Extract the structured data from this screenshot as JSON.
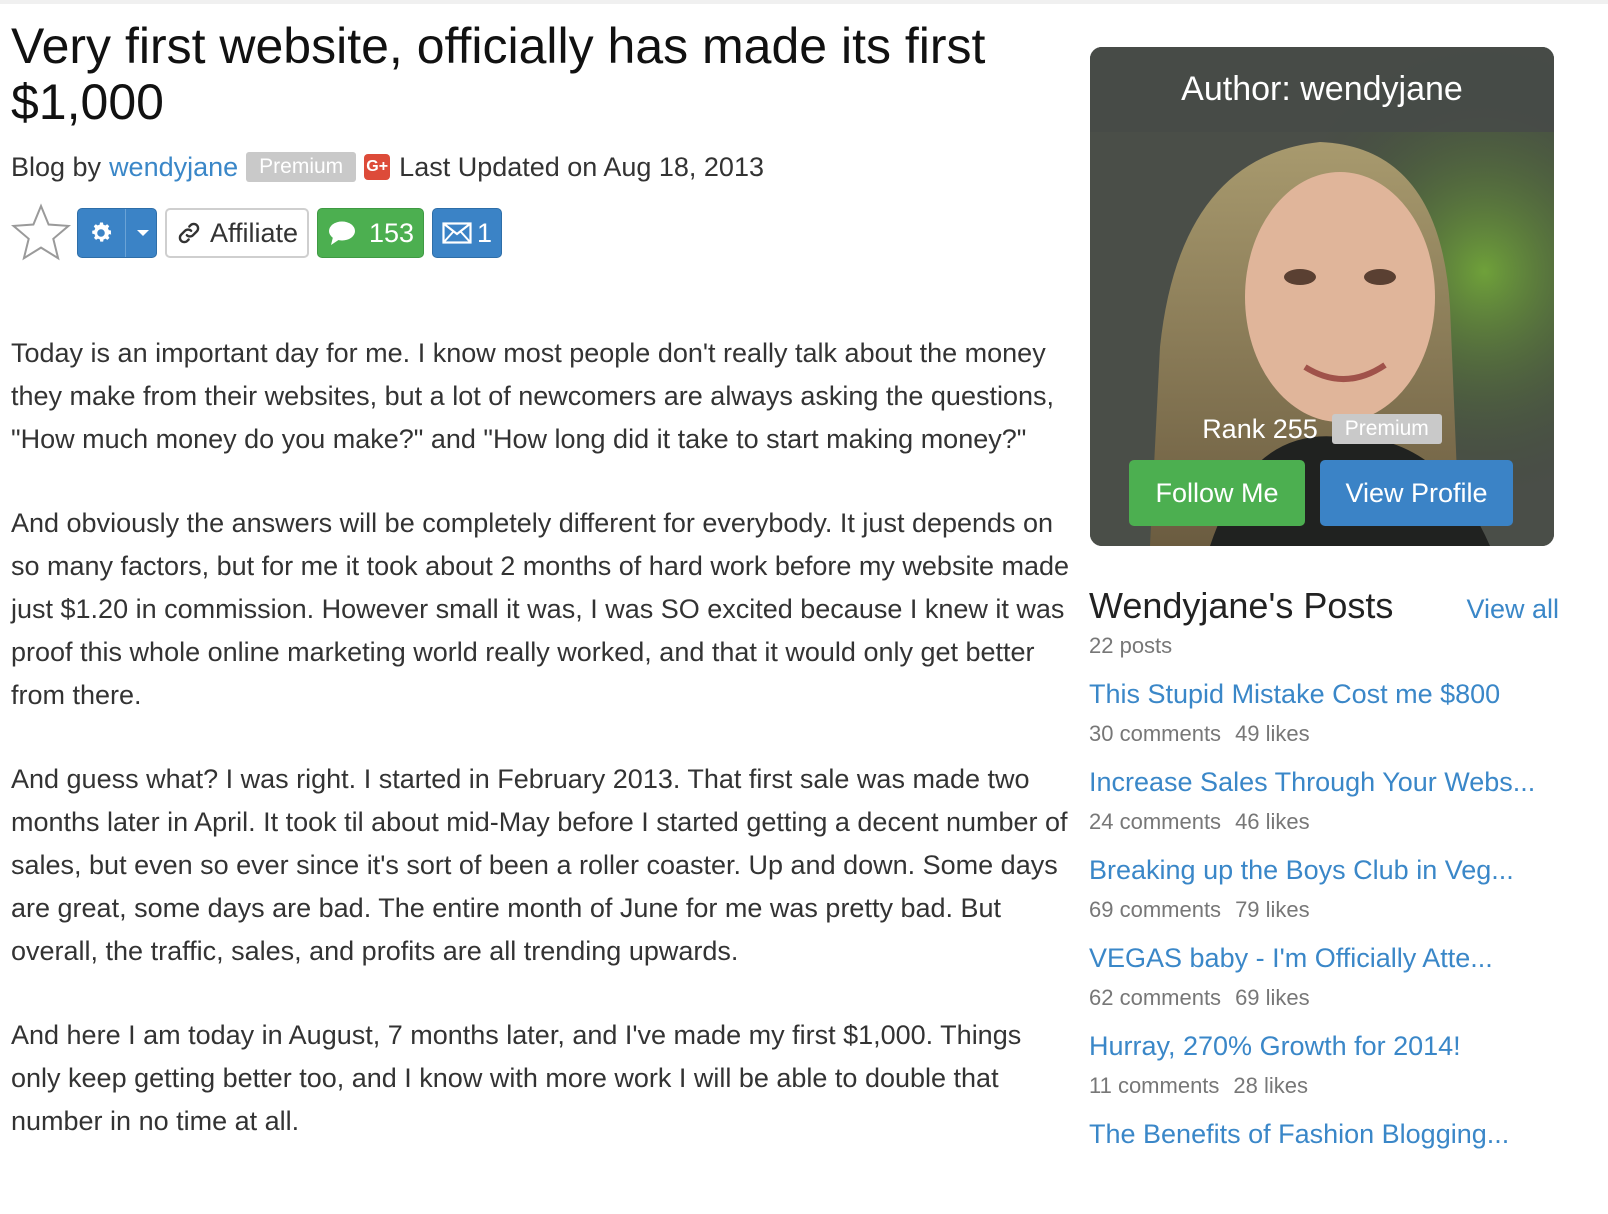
{
  "post": {
    "title": "Very first website, officially has made its first $1,000",
    "blog_by": "Blog by",
    "author": "wendyjane",
    "author_badge": "Premium",
    "gplus_label": "G+",
    "last_updated": "Last Updated on Aug 18, 2013"
  },
  "toolbar": {
    "affiliate_label": "Affiliate",
    "comments_count": "153",
    "messages_count": "1"
  },
  "article": {
    "paragraphs": [
      "Today is an important day for me. I know most people don't really talk about the money they make from their websites, but a lot of newcomers are always asking the questions, \"How much money do you make?\" and \"How long did it take to start making money?\"",
      "And obviously the answers will be completely different for everybody. It just depends on so many factors, but for me it took about 2 months of hard work before my website made just $1.20 in commission. However small it was, I was SO excited because I knew it was proof this whole online marketing world really worked, and that it would only get better from there.",
      "And guess what? I was right. I started in February 2013. That first sale was made two months later in April. It took til about mid-May before I started getting a decent number of sales, but even so ever since it's sort of been a roller coaster. Up and down. Some days are great, some days are bad. The entire month of June for me was pretty bad. But overall, the traffic, sales, and profits are all trending upwards.",
      "And here I am today in August, 7 months later, and I've made my first $1,000. Things only keep getting better too, and I know with more work I will be able to double that number in no time at all."
    ]
  },
  "author_card": {
    "heading": "Author: wendyjane",
    "rank": "Rank 255",
    "badge": "Premium",
    "follow_label": "Follow Me",
    "view_profile_label": "View Profile"
  },
  "posts": {
    "title": "Wendyjane's Posts",
    "view_all": "View all",
    "count": "22 posts",
    "items": [
      {
        "title": "This Stupid Mistake Cost me $800",
        "comments": "30 comments",
        "likes": "49 likes"
      },
      {
        "title": "Increase Sales Through Your Webs...",
        "comments": "24 comments",
        "likes": "46 likes"
      },
      {
        "title": "Breaking up the Boys Club in Veg...",
        "comments": "69 comments",
        "likes": "79 likes"
      },
      {
        "title": "VEGAS baby - I'm Officially Atte...",
        "comments": "62 comments",
        "likes": "69 likes"
      },
      {
        "title": "Hurray, 270% Growth for 2014!",
        "comments": "11 comments",
        "likes": "28 likes"
      },
      {
        "title": "The Benefits of Fashion Blogging...",
        "comments": "",
        "likes": ""
      }
    ]
  },
  "colors": {
    "link": "#3a87c8",
    "primary_button": "#3b83c6",
    "success_button": "#4caf50",
    "premium_badge": "#c9c9c9",
    "gplus": "#dd4b39"
  },
  "icons": [
    "star-icon",
    "gear-icon",
    "caret-down-icon",
    "link-icon",
    "comment-icon",
    "envelope-icon",
    "google-plus-icon"
  ]
}
